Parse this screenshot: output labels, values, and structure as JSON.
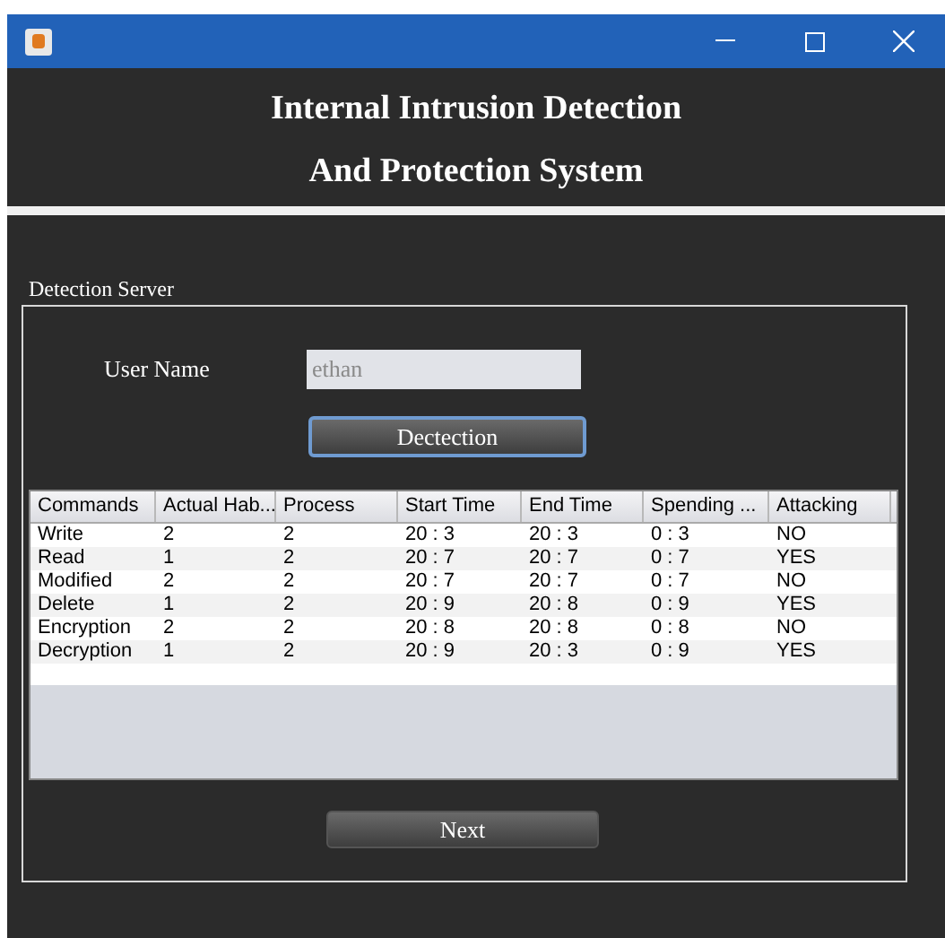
{
  "header": {
    "lines": [
      "Internal Intrusion Detection",
      "And Protection System"
    ]
  },
  "panel": {
    "title": "Detection Server"
  },
  "user_name": {
    "label": "User Name",
    "value": "ethan",
    "disabled": true
  },
  "detect_button": {
    "label": "Dectection",
    "focused": true
  },
  "table": {
    "columns": [
      "Commands",
      "Actual Hab...",
      "Process",
      "Start Time",
      "End Time",
      "Spending ...",
      "Attacking"
    ],
    "rows": [
      [
        "Write",
        "2",
        "2",
        "20 : 3",
        "20 : 3",
        "0 : 3",
        "NO"
      ],
      [
        "Read",
        "1",
        "2",
        "20 : 7",
        "20 : 7",
        "0 : 7",
        "YES"
      ],
      [
        "Modified",
        "2",
        "2",
        "20 : 7",
        "20 : 7",
        "0 : 7",
        "NO"
      ],
      [
        "Delete",
        "1",
        "2",
        "20 : 9",
        "20 : 8",
        "0 : 9",
        "YES"
      ],
      [
        "Encryption",
        "2",
        "2",
        "20 : 8",
        "20 : 8",
        "0 : 8",
        "NO"
      ],
      [
        "Decryption",
        "1",
        "2",
        "20 : 9",
        "20 : 3",
        "0 : 9",
        "YES"
      ]
    ]
  },
  "next_button": {
    "label": "Next"
  }
}
